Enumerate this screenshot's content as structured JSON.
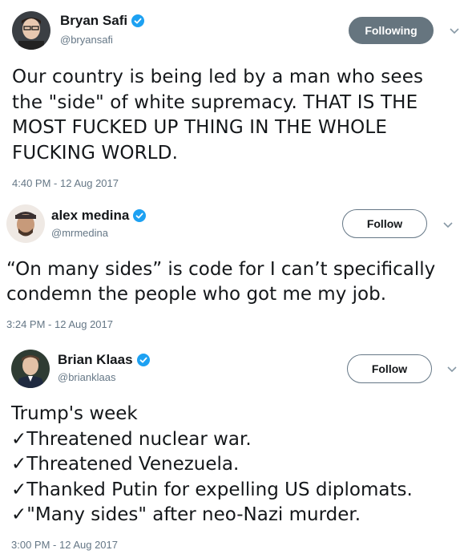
{
  "tweets": [
    {
      "name": "Bryan Safi",
      "handle": "@bryansafi",
      "button": "Following",
      "text": "Our country is being led by a man who sees\nthe \"side\" of white supremacy. THAT IS THE\nMOST FUCKED UP THING IN THE WHOLE\nFUCKING WORLD.",
      "timestamp": "4:40 PM - 12 Aug 2017"
    },
    {
      "name": "alex medina",
      "handle": "@mrmedina",
      "button": "Follow",
      "text": "“On many sides” is code for I can’t specifically\ncondemn the people who got me my job.",
      "timestamp": "3:24 PM - 12 Aug 2017"
    },
    {
      "name": "Brian Klaas",
      "handle": "@brianklaas",
      "button": "Follow",
      "text": "Trump's week\n✓Threatened nuclear war.\n✓Threatened Venezuela.\n✓Thanked Putin for expelling US diplomats.\n✓\"Many sides\" after neo-Nazi murder.",
      "timestamp": "3:00 PM - 12 Aug 2017"
    }
  ],
  "colors": {
    "verified": "#1da1f2",
    "following_bg": "#66757f",
    "secondary_text": "#657786"
  }
}
